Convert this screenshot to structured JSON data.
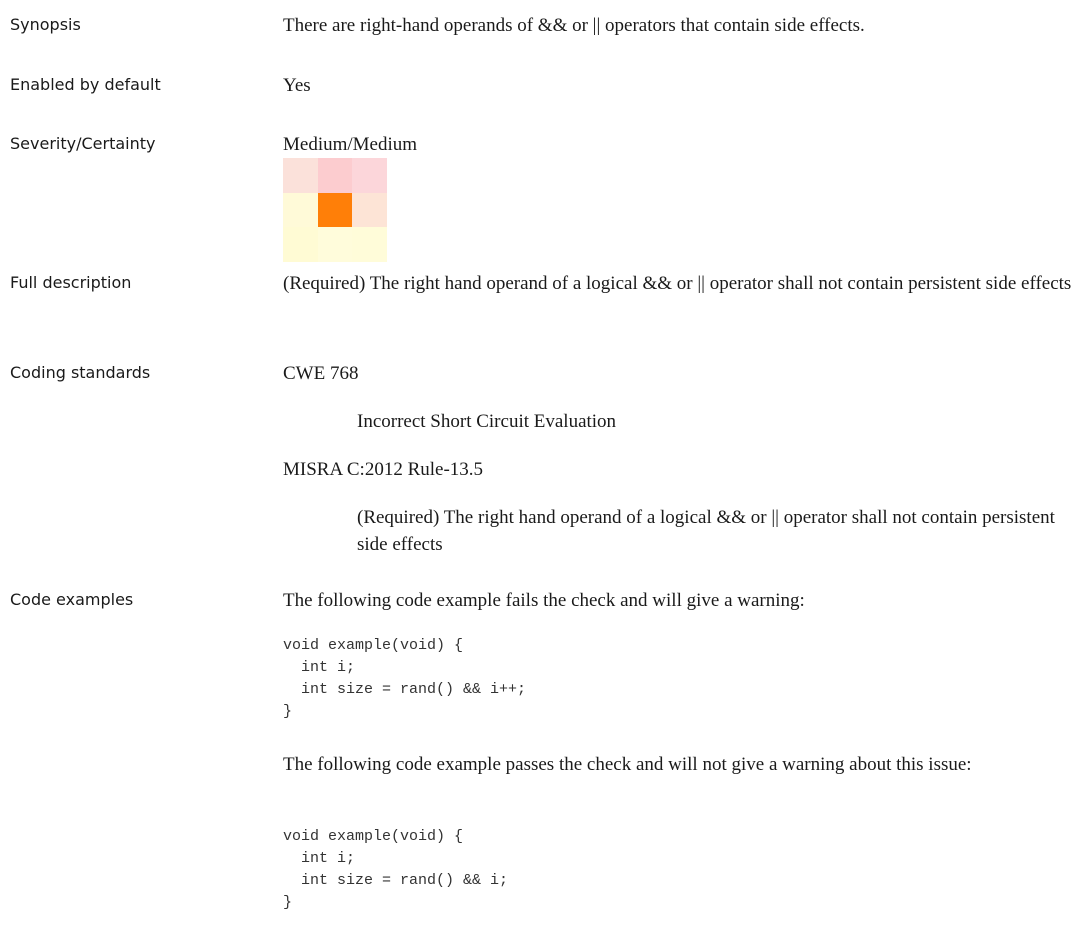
{
  "fields": {
    "synopsis": {
      "label": "Synopsis",
      "value": "There are right-hand operands of && or || operators that contain side effects."
    },
    "enabled": {
      "label": "Enabled by default",
      "value": "Yes"
    },
    "severity": {
      "label": "Severity/Certainty",
      "value": "Medium/Medium",
      "matrix_colors": [
        [
          "#fbe1da",
          "#fccccf",
          "#fcd6da"
        ],
        [
          "#fffad8",
          "#ff7f08",
          "#fde4d6"
        ],
        [
          "#fffbd4",
          "#fffcdb",
          "#fffcd9"
        ]
      ]
    },
    "full_description": {
      "label": "Full description",
      "value": "(Required) The right hand operand of a logical && or || operator shall not contain persistent side effects"
    },
    "coding_standards": {
      "label": "Coding standards",
      "items": [
        {
          "name": "CWE 768",
          "description": "Incorrect Short Circuit Evaluation"
        },
        {
          "name": "MISRA C:2012 Rule-13.5",
          "description": "(Required) The right hand operand of a logical && or || operator shall not contain persistent side effects"
        }
      ]
    },
    "code_examples": {
      "label": "Code examples",
      "fail_intro": "The following code example fails the check and will give a warning:",
      "fail_code": "void example(void) {\n  int i;\n  int size = rand() && i++;\n}",
      "pass_intro": "The following code example passes the check and will not give a warning about this issue:",
      "pass_code": "void example(void) {\n  int i;\n  int size = rand() && i;\n}"
    }
  }
}
